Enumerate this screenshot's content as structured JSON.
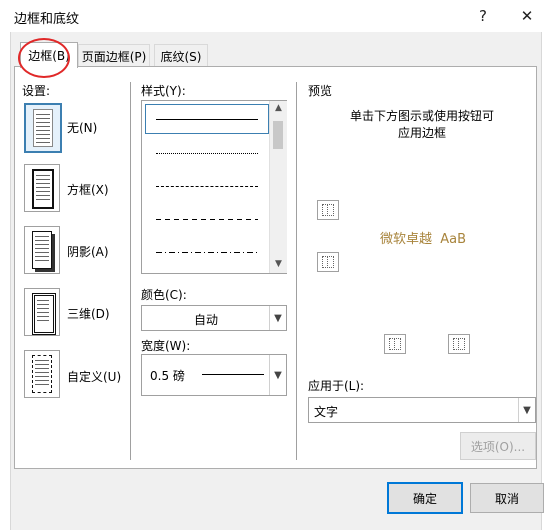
{
  "window": {
    "title": "边框和底纹",
    "help": "?",
    "close": "✕"
  },
  "tabs": [
    {
      "label": "边框(B)",
      "active": true
    },
    {
      "label": "页面边框(P)",
      "active": false
    },
    {
      "label": "底纹(S)",
      "active": false
    }
  ],
  "settings": {
    "heading": "设置:",
    "items": [
      {
        "label": "无(N)",
        "selected": true
      },
      {
        "label": "方框(X)",
        "selected": false
      },
      {
        "label": "阴影(A)",
        "selected": false
      },
      {
        "label": "三维(D)",
        "selected": false
      },
      {
        "label": "自定义(U)",
        "selected": false
      }
    ]
  },
  "style": {
    "heading": "样式(Y):",
    "color_label": "颜色(C):",
    "color_value": "自动",
    "width_label": "宽度(W):",
    "width_value": "0.5 磅"
  },
  "preview": {
    "heading": "预览",
    "instruction_line1": "单击下方图示或使用按钮可",
    "instruction_line2": "应用边框",
    "sample_text": "微软卓越  AaB",
    "apply_label": "应用于(L):",
    "apply_value": "文字",
    "options_button": "选项(O)..."
  },
  "footer": {
    "ok": "确定",
    "cancel": "取消"
  },
  "colors": {
    "accent": "#0078d7",
    "annotation": "#e02828",
    "preview_text": "#a8843c"
  }
}
